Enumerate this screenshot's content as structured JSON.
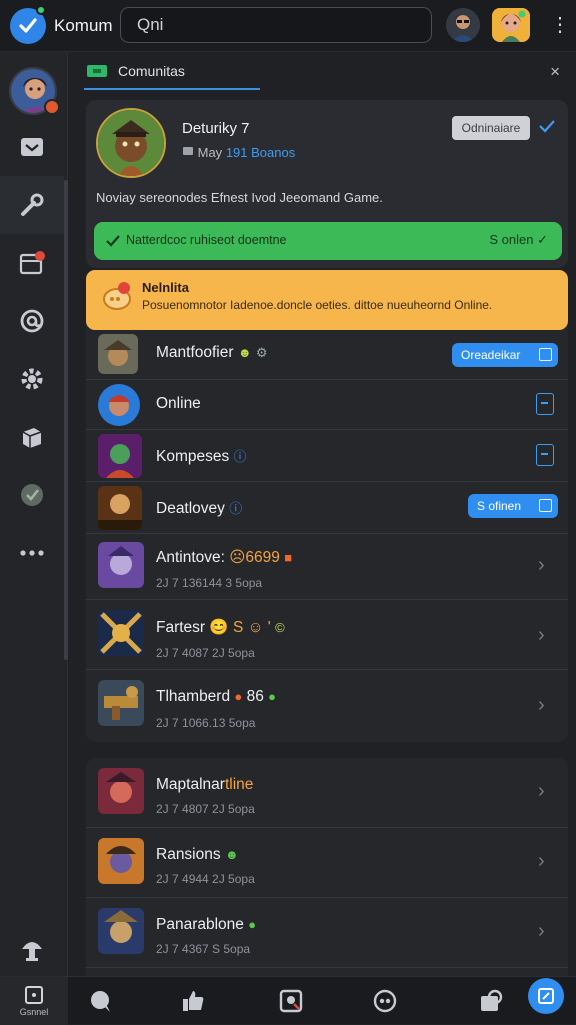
{
  "app": {
    "title": "Komum",
    "search_value": "Qni"
  },
  "tab": {
    "label": "Comunitas"
  },
  "header_card": {
    "title": "Deturiky 7",
    "meta_prefix": "May",
    "meta_highlight": "191 Boanos",
    "member_button": "Odninaiare",
    "description": "Noviay sereonodes Efnest Ivod Jeeomand Game.",
    "status_left": "Natterdcoc ruhiseot doemtne",
    "status_right": "S onlen"
  },
  "notice": {
    "title": "Nelnlita",
    "text": "Posuenomnotor Iadenoe.doncle oeties. dittoe nueuheornd Online."
  },
  "list_one": [
    {
      "title": "Mantfoofier",
      "sub": "",
      "action": "pill",
      "action_label": "Oreadeikar",
      "badges": [
        "green",
        "grey"
      ]
    },
    {
      "title": "Online",
      "sub": "",
      "action": "square",
      "action_label": "",
      "badges": []
    },
    {
      "title": "Kompeses",
      "sub": "",
      "action": "square",
      "action_label": "",
      "badges": [
        "blue"
      ]
    },
    {
      "title": "Deatlovey",
      "sub": "",
      "action": "pill",
      "action_label": "S ofinen",
      "badges": [
        "blue"
      ]
    },
    {
      "title": "Antintove:",
      "title_extra": "☹6699",
      "sub": "2J 7 136144 3 5opa",
      "action": "chevron",
      "badges": [
        "orange"
      ]
    },
    {
      "title": "Fartesr",
      "title_extra": "😊 S ☺ '",
      "sub": "2J 7 4087 2J 5opa",
      "action": "chevron",
      "badges": [
        "green"
      ]
    },
    {
      "title": "Tlhamberd",
      "title_extra": "86",
      "sub": "2J 7 1066.13 5opa",
      "action": "chevron",
      "badges": [
        "orange",
        "green"
      ]
    }
  ],
  "list_two": [
    {
      "title": "Maptalnar",
      "title_extra": "tline",
      "sub": "2J 7 4807 2J 5opa",
      "action": "chevron",
      "badges": []
    },
    {
      "title": "Ransions",
      "sub": "2J 7 4944 2J 5opa",
      "action": "chevron",
      "badges": [
        "green"
      ]
    },
    {
      "title": "Panarablone",
      "sub": "2J 7 4367 S 5opa",
      "action": "chevron",
      "badges": [
        "green"
      ]
    }
  ],
  "bottom": {
    "home_label": "Gsnnel"
  },
  "colors": {
    "accent": "#2f8ef0",
    "green": "#3cba58",
    "notice": "#f6b64b",
    "background": "#1f2125"
  },
  "icons": [
    "check-logo-icon",
    "inbox-icon",
    "tools-icon",
    "calendar-icon",
    "mention-icon",
    "gear-icon",
    "cube-icon",
    "globe-icon",
    "more-icon",
    "mushroom-icon"
  ]
}
